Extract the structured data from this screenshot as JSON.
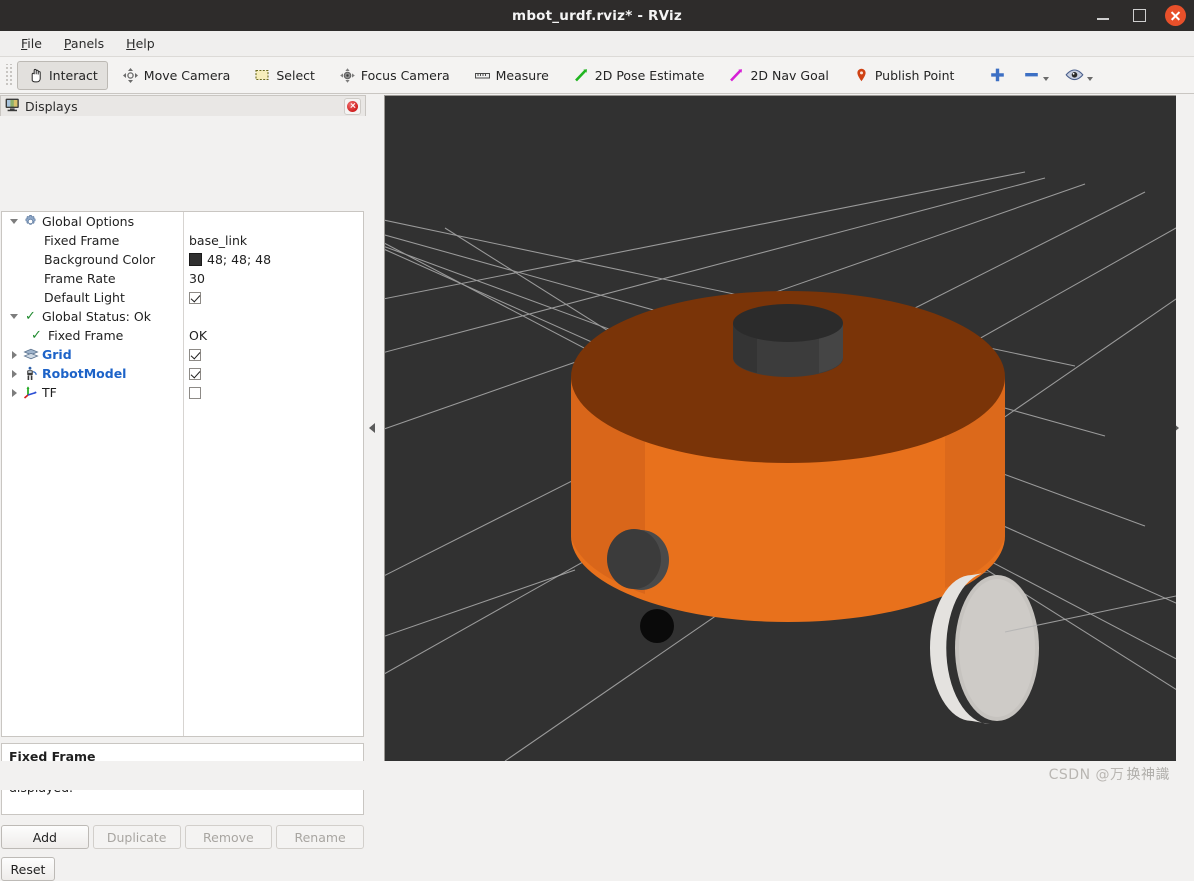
{
  "window": {
    "title": "mbot_urdf.rviz* - RViz",
    "minimize_label": "Minimize",
    "maximize_label": "Maximize",
    "close_label": "Close"
  },
  "menubar": {
    "items": [
      {
        "label": "File",
        "mnemonic": "F",
        "rest": "ile"
      },
      {
        "label": "Panels",
        "mnemonic": "P",
        "rest": "anels"
      },
      {
        "label": "Help",
        "mnemonic": "H",
        "rest": "elp"
      }
    ]
  },
  "toolbar": {
    "items": [
      {
        "label": "Interact",
        "icon": "hand-cursor-icon",
        "active": true
      },
      {
        "label": "Move Camera",
        "icon": "move-camera-icon",
        "active": false
      },
      {
        "label": "Select",
        "icon": "select-box-icon",
        "active": false
      },
      {
        "label": "Focus Camera",
        "icon": "focus-camera-icon",
        "active": false
      },
      {
        "label": "Measure",
        "icon": "ruler-icon",
        "active": false
      },
      {
        "label": "2D Pose Estimate",
        "icon": "green-arrow-icon",
        "active": false
      },
      {
        "label": "2D Nav Goal",
        "icon": "magenta-arrow-icon",
        "active": false
      },
      {
        "label": "Publish Point",
        "icon": "map-pin-icon",
        "active": false
      }
    ],
    "right_icons": [
      {
        "name": "add-panel-icon",
        "glyph": "plus"
      },
      {
        "name": "remove-panel-icon",
        "glyph": "minus"
      },
      {
        "name": "visibility-eye-icon",
        "glyph": "eye"
      }
    ]
  },
  "displays_panel": {
    "title": "Displays",
    "icon": "displays-monitor-icon",
    "close_label": "Close Displays panel",
    "rows": [
      {
        "label": "Global Options",
        "value": "",
        "indent": 0,
        "expander": "down",
        "icon": "gear-icon",
        "value_type": "none",
        "bold": false
      },
      {
        "label": "Fixed Frame",
        "value": "base_link",
        "indent": 1,
        "expander": "none",
        "icon": "none",
        "value_type": "text",
        "bold": false
      },
      {
        "label": "Background Color",
        "value": "48; 48; 48",
        "indent": 1,
        "expander": "none",
        "icon": "none",
        "value_type": "color",
        "color": "#303030",
        "bold": false
      },
      {
        "label": "Frame Rate",
        "value": "30",
        "indent": 1,
        "expander": "none",
        "icon": "none",
        "value_type": "text",
        "bold": false
      },
      {
        "label": "Default Light",
        "value": "",
        "indent": 1,
        "expander": "none",
        "icon": "none",
        "value_type": "checkbox",
        "checked": true,
        "bold": false
      },
      {
        "label": "Global Status: Ok",
        "value": "",
        "indent": 0,
        "expander": "down",
        "icon": "green-check-icon",
        "value_type": "none",
        "bold": false
      },
      {
        "label": "Fixed Frame",
        "value": "OK",
        "indent": 1,
        "expander": "none",
        "icon": "green-check-icon",
        "value_type": "text",
        "bold": false
      },
      {
        "label": "Grid",
        "value": "",
        "indent": 0,
        "expander": "right",
        "icon": "grid-icon",
        "value_type": "checkbox",
        "checked": true,
        "bold": true
      },
      {
        "label": "RobotModel",
        "value": "",
        "indent": 0,
        "expander": "right",
        "icon": "robot-icon",
        "value_type": "checkbox",
        "checked": true,
        "bold": true
      },
      {
        "label": "TF",
        "value": "",
        "indent": 0,
        "expander": "right",
        "icon": "tf-axes-icon",
        "value_type": "checkbox",
        "checked": false,
        "bold": false
      }
    ]
  },
  "help": {
    "title": "Fixed Frame",
    "body": "Frame into which all data is transformed before being displayed."
  },
  "buttons": {
    "add": {
      "label": "Add",
      "enabled": true
    },
    "duplicate": {
      "label": "Duplicate",
      "enabled": false
    },
    "remove": {
      "label": "Remove",
      "enabled": false
    },
    "rename": {
      "label": "Rename",
      "enabled": false
    },
    "reset": {
      "label": "Reset",
      "enabled": true
    }
  },
  "view3d": {
    "background_color": "#313131",
    "grid_color": "#b4b4b4",
    "robot": {
      "body_side_color": "#e8711c",
      "body_top_color": "#7a3408",
      "lidar_color": "#3c3c3c",
      "wheel_color": "#cdcac6",
      "caster_color": "#0a0a0a",
      "camera_color": "#3b3b3b"
    }
  },
  "watermark": {
    "text": "CSDN @万",
    "text_cjk": "换神識"
  }
}
